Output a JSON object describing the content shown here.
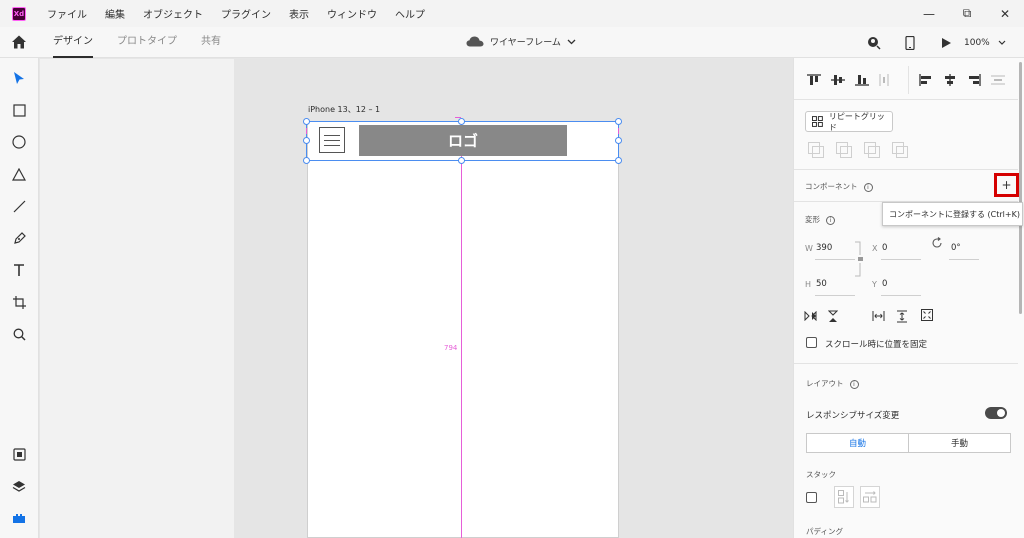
{
  "app": {
    "logo_text": "Xd"
  },
  "menu": [
    "ファイル",
    "編集",
    "オブジェクト",
    "プラグイン",
    "表示",
    "ウィンドウ",
    "ヘルプ"
  ],
  "window_controls": {
    "minimize": "—",
    "maximize": "⧉",
    "close": "✕"
  },
  "tabs": [
    {
      "label": "デザイン",
      "active": true
    },
    {
      "label": "プロトタイプ",
      "active": false
    },
    {
      "label": "共有",
      "active": false
    }
  ],
  "document": {
    "name": "ワイヤーフレーム"
  },
  "zoom": {
    "label": "100%"
  },
  "left_tools": [
    "select-icon",
    "rectangle-icon",
    "ellipse-icon",
    "polygon-icon",
    "line-icon",
    "pen-icon",
    "text-icon",
    "artboard-icon",
    "zoom-icon",
    "assets-icon",
    "layers-icon",
    "plugins-icon"
  ],
  "canvas": {
    "artboard_title": "iPhone 13、12 – 1",
    "logo_text": "ロゴ",
    "guide_distance": "794"
  },
  "panel": {
    "repeat_grid_label": "リピートグリッド",
    "component_label": "コンポーネント",
    "add_component": "+",
    "tooltip": "コンポーネントに登録する (Ctrl+K)",
    "transform_label": "変形",
    "w_label": "W",
    "w_value": "390",
    "x_label": "X",
    "x_value": "0",
    "rotation_value": "0°",
    "h_label": "H",
    "h_value": "50",
    "y_label": "Y",
    "y_value": "0",
    "fix_scroll_label": "スクロール時に位置を固定",
    "layout_label": "レイアウト",
    "responsive_label": "レスポンシブサイズ変更",
    "responsive_on": true,
    "auto_label": "自動",
    "manual_label": "手動",
    "stack_label": "スタック",
    "padding_label": "パディング"
  },
  "colors": {
    "selection": "#4b8df0",
    "guide": "#e65fd8",
    "highlight": "#d50000",
    "accent": "#1473e6"
  }
}
